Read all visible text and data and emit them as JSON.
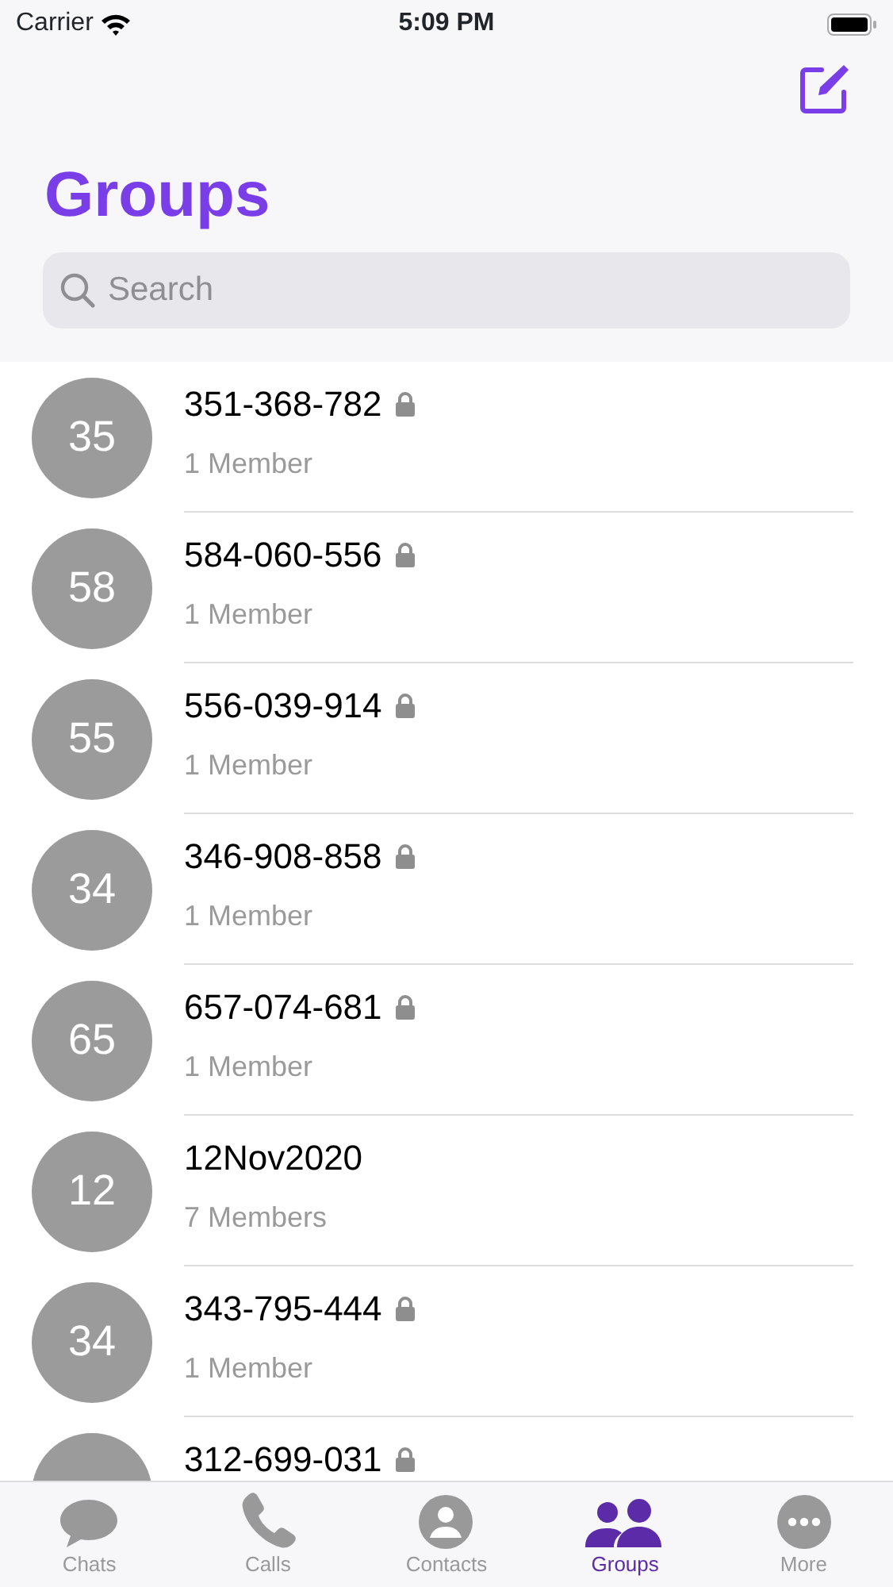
{
  "status_bar": {
    "carrier": "Carrier",
    "time": "5:09 PM"
  },
  "title": "Groups",
  "search": {
    "placeholder": "Search"
  },
  "groups": [
    {
      "avatar": "35",
      "name": "351-368-782",
      "locked": true,
      "members": "1 Member"
    },
    {
      "avatar": "58",
      "name": "584-060-556",
      "locked": true,
      "members": "1 Member"
    },
    {
      "avatar": "55",
      "name": "556-039-914",
      "locked": true,
      "members": "1 Member"
    },
    {
      "avatar": "34",
      "name": "346-908-858",
      "locked": true,
      "members": "1 Member"
    },
    {
      "avatar": "65",
      "name": "657-074-681",
      "locked": true,
      "members": "1 Member"
    },
    {
      "avatar": "12",
      "name": "12Nov2020",
      "locked": false,
      "members": "7 Members"
    },
    {
      "avatar": "34",
      "name": "343-795-444",
      "locked": true,
      "members": "1 Member"
    },
    {
      "name": "312-699-031",
      "locked": true
    }
  ],
  "tab_bar": [
    {
      "kind": "chats",
      "label": "Chats",
      "selected": false
    },
    {
      "kind": "calls",
      "label": "Calls",
      "selected": false
    },
    {
      "kind": "contacts",
      "label": "Contacts",
      "selected": false
    },
    {
      "kind": "groups",
      "label": "Groups",
      "selected": true
    },
    {
      "kind": "more",
      "label": "More",
      "selected": false
    }
  ]
}
